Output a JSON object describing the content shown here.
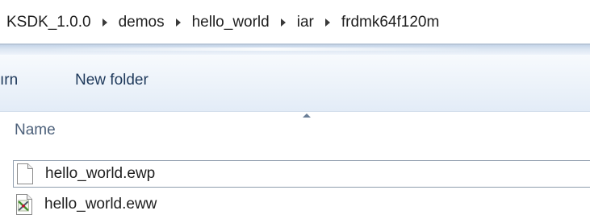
{
  "breadcrumb": {
    "items": [
      "KSDK_1.0.0",
      "demos",
      "hello_world",
      "iar",
      "frdmk64f120m"
    ],
    "separator_icon": "chevron-right-icon"
  },
  "command_bar": {
    "partial_item_label": "ırn",
    "new_folder_label": "New folder"
  },
  "column_header": {
    "name_label": "Name",
    "sort_icon": "sort-ascending-arrow-icon"
  },
  "files": [
    {
      "name": "hello_world.ewp",
      "icon": "blank-file-icon",
      "focused": true
    },
    {
      "name": "hello_world.eww",
      "icon": "iar-workspace-file-icon",
      "focused": false
    }
  ],
  "colors": {
    "command_bar_text": "#1e395b",
    "column_header_text": "#4c607a",
    "address_border": "#b8c6d8"
  }
}
